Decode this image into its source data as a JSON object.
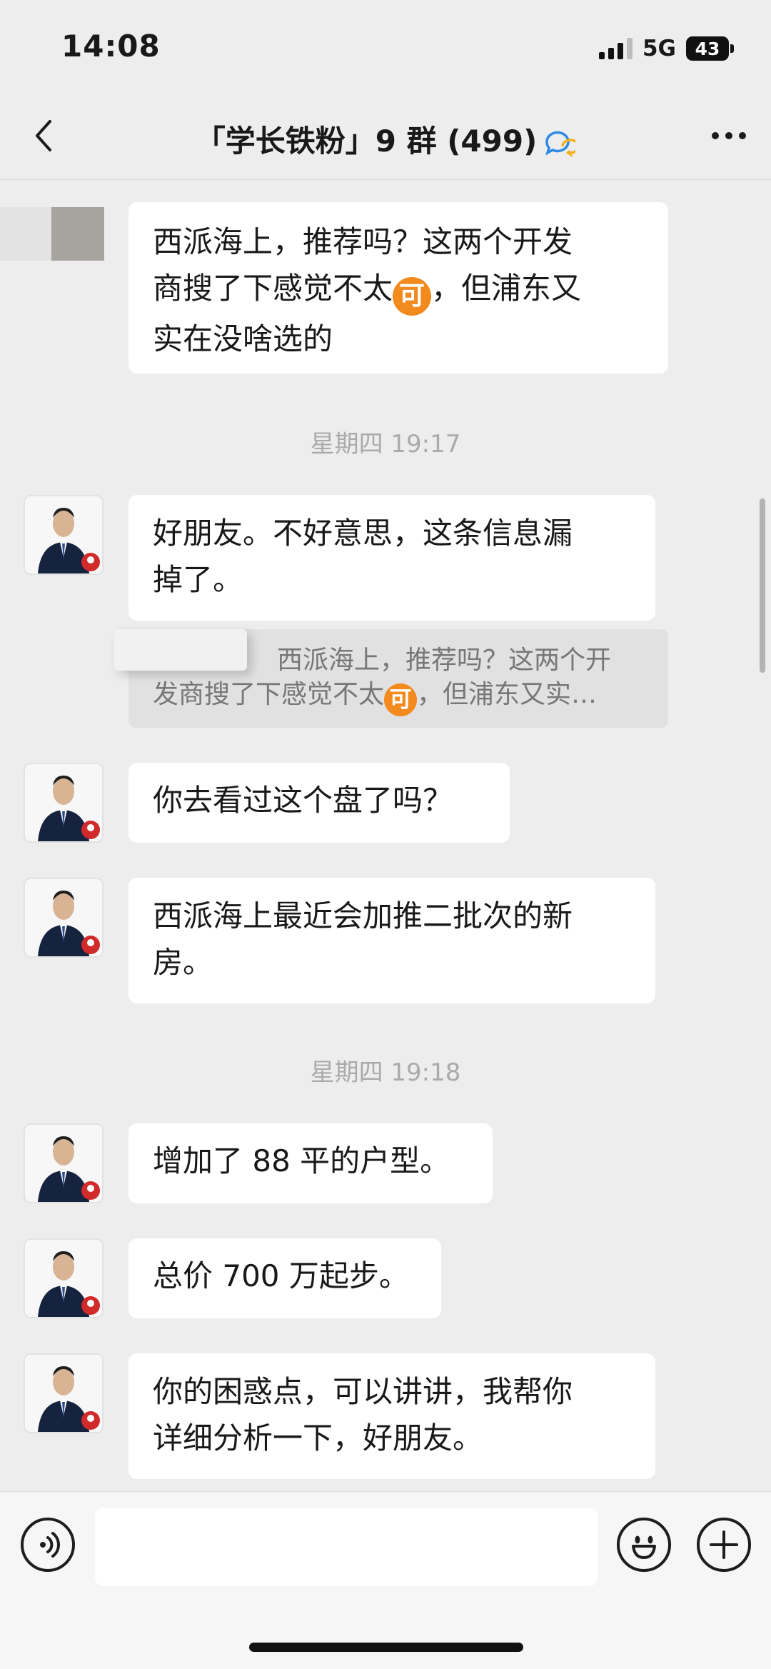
{
  "status_bar": {
    "time": "14:08",
    "network": "5G",
    "battery": "43"
  },
  "header": {
    "title": "「学长铁粉」9 群 (499)",
    "back_icon": "chevron-left-icon",
    "more_icon": "more-dots-icon",
    "badge_icon": "group-chat-badge-icon"
  },
  "messages": [
    {
      "type": "text",
      "lines": [
        "西派海上，推荐吗？这两个开发",
        "商搜了下感觉不太",
        "，但浦东又",
        "实在没啥选的"
      ],
      "emoji": "可"
    },
    {
      "type": "timestamp",
      "text": "星期四 19:17"
    },
    {
      "type": "text",
      "lines": [
        "好朋友。不好意思，这条信息漏",
        "掉了。"
      ]
    },
    {
      "type": "quote",
      "lines": [
        "西派海上，推荐吗？这两个开",
        "发商搜了下感觉不太",
        "，但浦东又实…"
      ],
      "emoji": "可"
    },
    {
      "type": "text",
      "lines": [
        "你去看过这个盘了吗？"
      ]
    },
    {
      "type": "text",
      "lines": [
        "西派海上最近会加推二批次的新",
        "房。"
      ]
    },
    {
      "type": "timestamp",
      "text": "星期四 19:18"
    },
    {
      "type": "text",
      "lines": [
        "增加了 88 平的户型。"
      ]
    },
    {
      "type": "text",
      "lines": [
        "总价 700 万起步。"
      ]
    },
    {
      "type": "text",
      "lines": [
        "你的困惑点，可以讲讲，我帮你",
        "详细分析一下，好朋友。"
      ]
    }
  ],
  "input_bar": {
    "placeholder": "",
    "voice_icon": "voice-icon",
    "emoji_icon": "emoji-icon",
    "plus_icon": "plus-icon"
  }
}
